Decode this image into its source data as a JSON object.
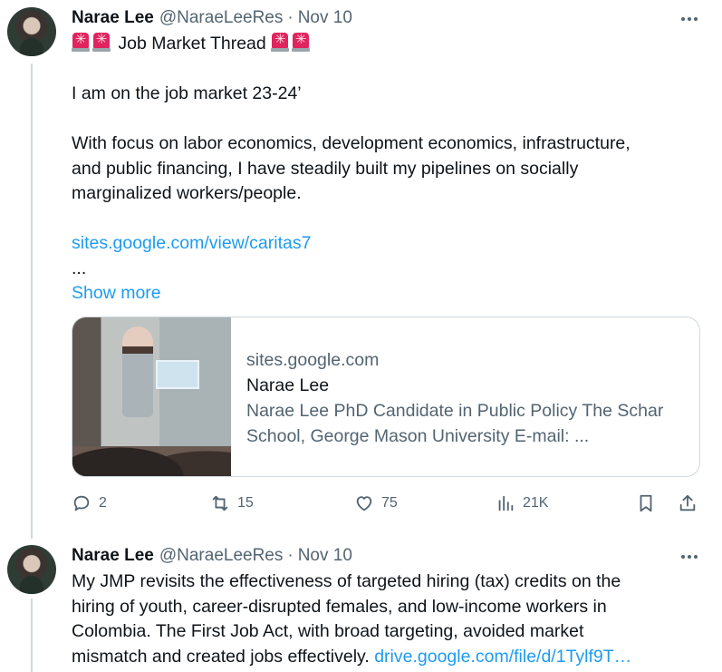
{
  "tweets": [
    {
      "name": "Narae Lee",
      "handle": "@NaraeLeeRes",
      "separator": "·",
      "date": "Nov 10",
      "title_text": "Job Market Thread",
      "body_line_1": "I am on the job market 23-24’",
      "body_line_2": "With focus on labor economics, development economics, infrastructure,",
      "body_line_3": "and public financing, I have steadily built my pipelines on socially",
      "body_line_4": "marginalized workers/people.",
      "link": "sites.google.com/view/caritas7",
      "ellipsis": "...",
      "show_more": "Show more",
      "card": {
        "domain": "sites.google.com",
        "title": "Narae Lee",
        "desc_line_1": "Narae Lee PhD Candidate in Public Policy The Schar",
        "desc_line_2": "School, George Mason University E-mail: ..."
      },
      "actions": {
        "replies": "2",
        "reposts": "15",
        "likes": "75",
        "views": "21K"
      }
    },
    {
      "name": "Narae Lee",
      "handle": "@NaraeLeeRes",
      "separator": "·",
      "date": "Nov 10",
      "body_line_1": "My JMP revisits the effectiveness of targeted hiring (tax) credits on the",
      "body_line_2": "hiring of youth, career-disrupted females, and low-income workers in",
      "body_line_3": "Colombia. The First Job Act, with broad targeting, avoided market",
      "body_line_4": "mismatch and created jobs effectively.",
      "link": "drive.google.com/file/d/1Tylf9T…"
    }
  ],
  "icons": {
    "siren": "police-car-light-icon",
    "more": "more-horizontal-icon",
    "reply": "reply-icon",
    "repost": "repost-icon",
    "like": "heart-icon",
    "views": "views-icon",
    "bookmark": "bookmark-icon",
    "share": "share-icon"
  },
  "colors": {
    "link": "#1d9bf0",
    "secondary_text": "#536471",
    "siren": "#e0245e"
  }
}
